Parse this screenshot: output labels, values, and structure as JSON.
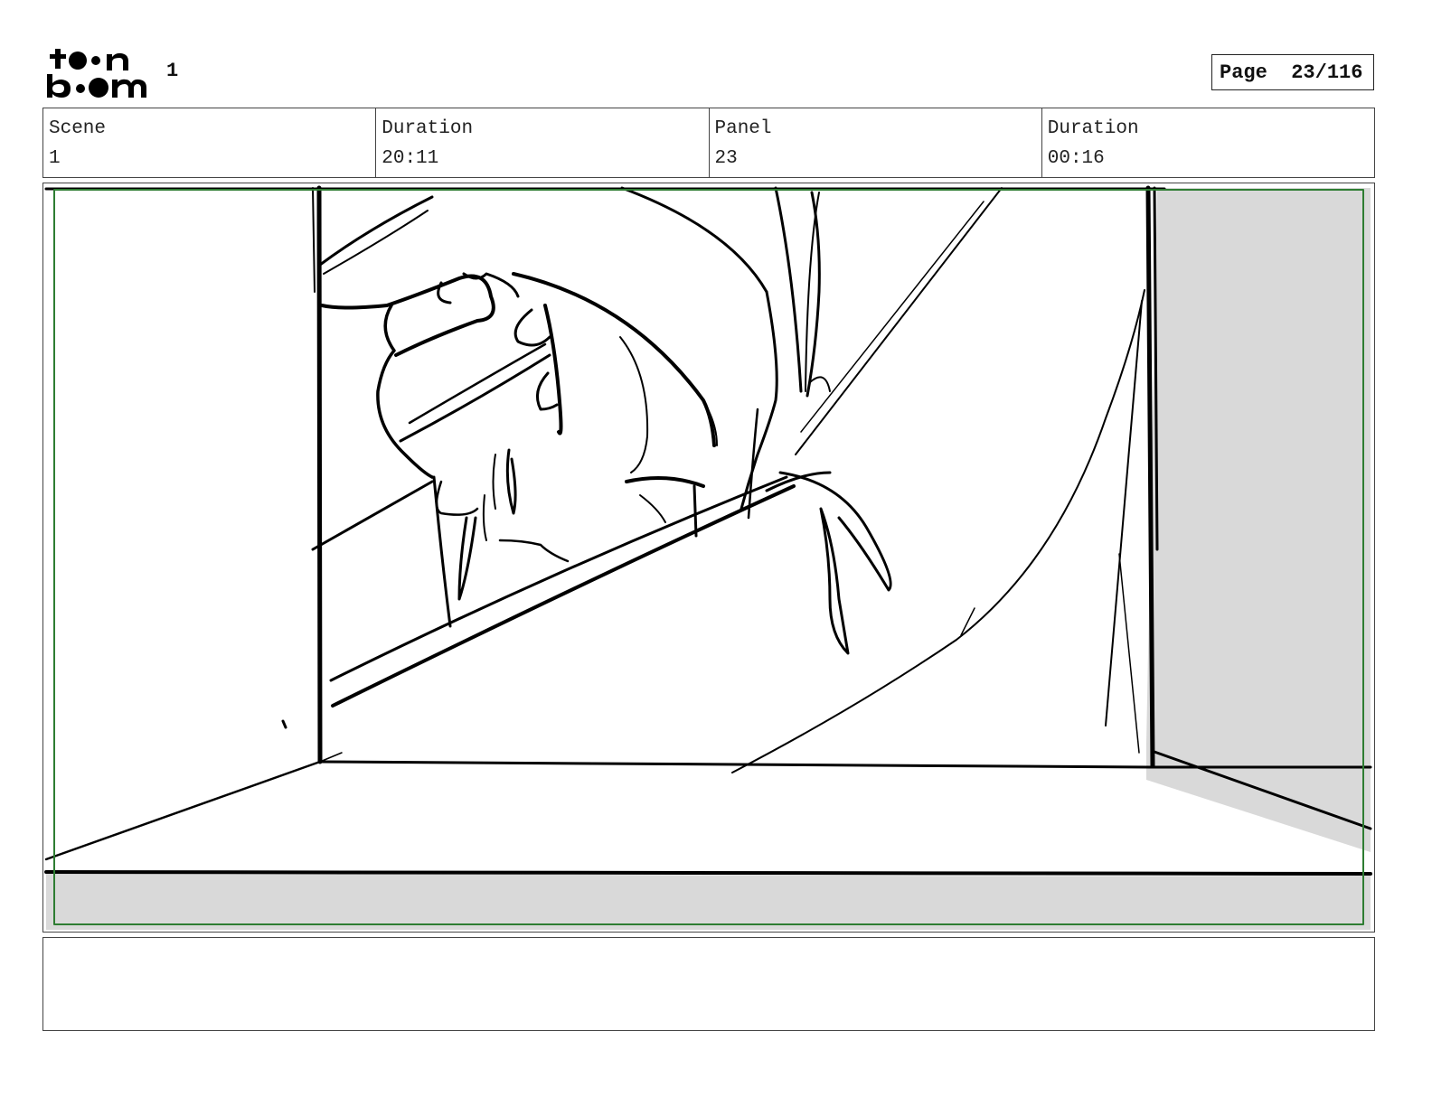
{
  "header": {
    "logo_text": "toon boom",
    "scene_number": "1",
    "page_label": "Page",
    "page_value": "23/116"
  },
  "info": {
    "scene_label": "Scene",
    "scene_value": "1",
    "duration_label": "Duration",
    "duration_value": "20:11",
    "panel_label": "Panel",
    "panel_value": "23",
    "panel_duration_label": "Duration",
    "panel_duration_value": "00:16"
  },
  "notes": {
    "text": ""
  },
  "colors": {
    "safe_frame": "#2e7d32",
    "shadow": "#d9d9d9",
    "ink": "#000000"
  }
}
